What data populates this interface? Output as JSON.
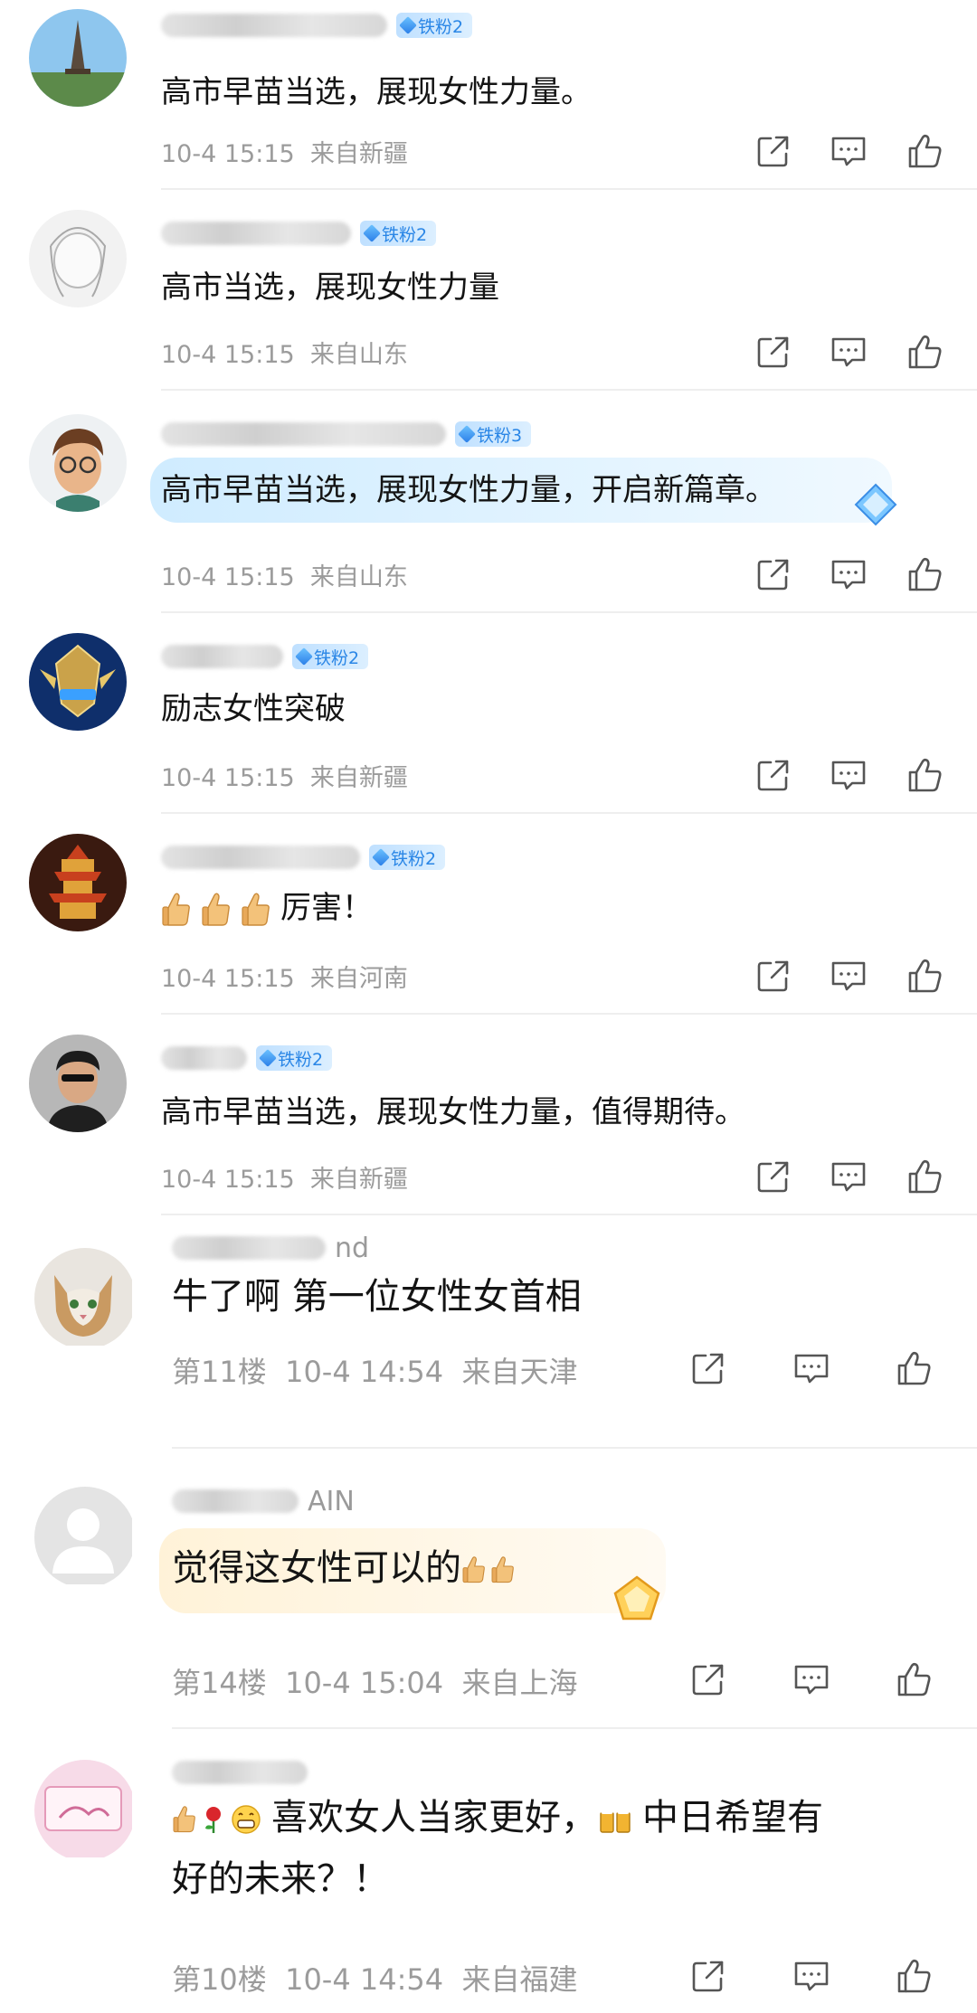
{
  "comments": [
    {
      "name_fragment": "",
      "badge": "铁粉2",
      "text": "高市早苗当选，展现女性力量。",
      "time": "10-4 15:15",
      "location": "来自新疆"
    },
    {
      "name_fragment": "",
      "badge": "铁粉2",
      "text": "高市当选，展现女性力量",
      "time": "10-4 15:15",
      "location": "来自山东"
    },
    {
      "name_fragment": "",
      "badge": "铁粉3",
      "text": "高市早苗当选，展现女性力量，开启新篇章。",
      "time": "10-4 15:15",
      "location": "来自山东"
    },
    {
      "name_fragment": "",
      "badge": "铁粉2",
      "text": "励志女性突破",
      "time": "10-4 15:15",
      "location": "来自新疆"
    },
    {
      "name_fragment": "",
      "badge": "铁粉2",
      "text": "厉害！",
      "time": "10-4 15:15",
      "location": "来自河南"
    },
    {
      "name_fragment": "",
      "badge": "铁粉2",
      "text": "高市早苗当选，展现女性力量，值得期待。",
      "time": "10-4 15:15",
      "location": "来自新疆"
    },
    {
      "name_fragment": "nd",
      "text": "牛了啊 第一位女性女首相",
      "floor": "第11楼",
      "time": "10-4 14:54",
      "location": "来自天津"
    },
    {
      "name_fragment": "AIN",
      "text": "觉得这女性可以的",
      "floor": "第14楼",
      "time": "10-4 15:04",
      "location": "来自上海"
    },
    {
      "name_fragment": "",
      "text_line1": "喜欢女人当家更好，",
      "text_line1b": "中日希望有",
      "text_line2": "好的未来？！",
      "floor": "第10楼",
      "time": "10-4 14:54",
      "location": "来自福建"
    }
  ],
  "icons": {
    "share": "share-icon",
    "comment": "comment-icon",
    "like": "like-icon",
    "thumb_emoji": "thumbs-up-emoji",
    "rose_emoji": "rose-emoji",
    "grin_emoji": "grin-emoji",
    "beer_emoji": "beer-emoji"
  },
  "colors": {
    "badge_text": "#2a86e6",
    "meta_text": "#9b9b9b",
    "divider": "#eeeeee"
  }
}
